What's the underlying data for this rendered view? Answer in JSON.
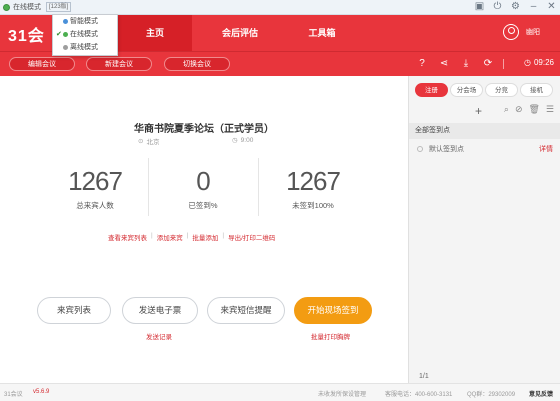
{
  "titlebar": {
    "status": "在线模式",
    "version_box": "[123版]"
  },
  "mode_menu": {
    "items": [
      {
        "label": "智能模式",
        "dot_color": "#4a90d9",
        "checked": false
      },
      {
        "label": "在线模式",
        "dot_color": "#4caf50",
        "checked": true
      },
      {
        "label": "离线模式",
        "dot_color": "#9e9e9e",
        "checked": false
      }
    ]
  },
  "header": {
    "logo": "31会",
    "nav": [
      "主页",
      "会后评估",
      "工具箱"
    ],
    "active_nav": 0,
    "user": "幽阳"
  },
  "toolbar": {
    "buttons": [
      "编辑会议",
      "新建会议",
      "切换会议"
    ],
    "time": "09:26"
  },
  "main": {
    "title": "华商书院夏季论坛（正式学员）",
    "location": "北京",
    "time": "9:00",
    "stats": [
      {
        "value": "1267",
        "label": "总来宾人数"
      },
      {
        "value": "0",
        "label": "已签到%"
      },
      {
        "value": "1267",
        "label": "未签到100%"
      }
    ],
    "links": [
      "查看来宾列表",
      "添加来宾",
      "批量添加",
      "导出/打印二维码"
    ],
    "buttons": [
      "来宾列表",
      "发送电子票",
      "来宾短信提醒",
      "开始现场签到"
    ],
    "sub_links": [
      "发送记录",
      "批量打印胸牌"
    ]
  },
  "side": {
    "tabs": [
      "注册",
      "分会场",
      "分竞",
      "接机"
    ],
    "active_tab": 0,
    "section_title": "全部签到点",
    "rows": [
      {
        "label": "默认签到点",
        "action": "详情"
      }
    ],
    "pager": "1/1"
  },
  "footer": {
    "app": "31会议",
    "version": "v5.6.9",
    "links": [
      "未收发所保设管理",
      "客服电话：400-600-3131",
      "QQ群：29302009",
      "意见反馈"
    ]
  },
  "colors": {
    "brand": "#e8353c",
    "accent": "#f39c12"
  }
}
